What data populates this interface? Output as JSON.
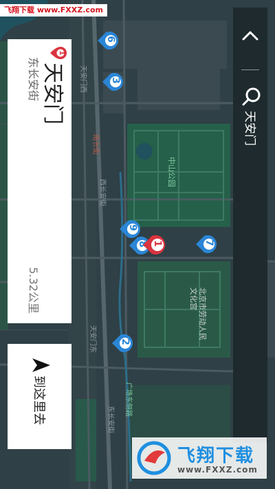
{
  "watermark": {
    "text": "飞翔下载 www.FXXZ.com"
  },
  "place": {
    "marker_number": "1",
    "title": "天安门",
    "subtitle": "东长安街",
    "distance": "5.32公里"
  },
  "go_button": {
    "label": "到这里去",
    "icon": "navigation-arrow-icon"
  },
  "search": {
    "query": "天安门",
    "back_icon": "chevron-back-icon",
    "search_icon": "search-icon"
  },
  "map": {
    "labels": {
      "zhongshan_park": "中山公园",
      "culture_palace": "北京市劳动人民文化宫",
      "xi_changan": "西长安街",
      "dong_changan": "东长安街",
      "nanchang": "南长街",
      "tiananmen_west": "天安门西",
      "tiananmen_east": "天安门东",
      "guangchang": "广场东侧路"
    },
    "markers": [
      {
        "num": "6"
      },
      {
        "num": "3"
      },
      {
        "num": "9"
      },
      {
        "num": "8"
      },
      {
        "num": "1"
      },
      {
        "num": "7"
      },
      {
        "num": "2"
      }
    ],
    "colors": {
      "blue_marker": "#2b86d6",
      "red_marker": "#d9343f",
      "park": "#25604a",
      "road": "#4c5b61"
    }
  },
  "logo": {
    "name": "飞翔下载",
    "url": "www.FXXZ.com"
  }
}
